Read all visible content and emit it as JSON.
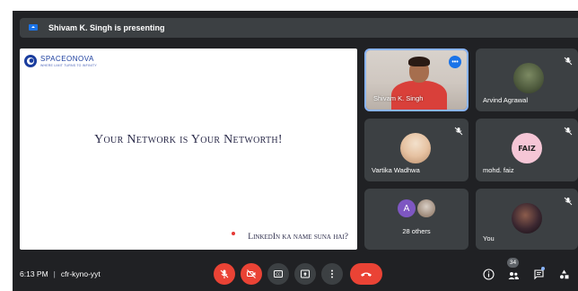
{
  "banner": {
    "text": "Shivam K. Singh is presenting"
  },
  "slide": {
    "brand_name": "SPACEONOVA",
    "brand_tagline": "WHERE LIMIT TURNS TO INFINITY",
    "headline": "Your Network is Your Networth!",
    "footline": "LinkedIn ka name suna hai?"
  },
  "tiles": {
    "presenter": {
      "name": "Shivam K. Singh"
    },
    "arvind": {
      "name": "Arvind Agrawal"
    },
    "vartika": {
      "name": "Vartika Wadhwa"
    },
    "faiz": {
      "name": "mohd. faiz",
      "avatar_text": "FAIZ"
    },
    "others": {
      "label": "28 others",
      "initial": "A"
    },
    "you": {
      "name": "You"
    }
  },
  "bottombar": {
    "time": "6:13 PM",
    "separator": "|",
    "meeting_code": "cfr-kyno-yyt",
    "participants_count": "34"
  },
  "colors": {
    "background": "#202124",
    "tile": "#3c4043",
    "accent": "#8ab4f8",
    "danger": "#ea4335"
  }
}
